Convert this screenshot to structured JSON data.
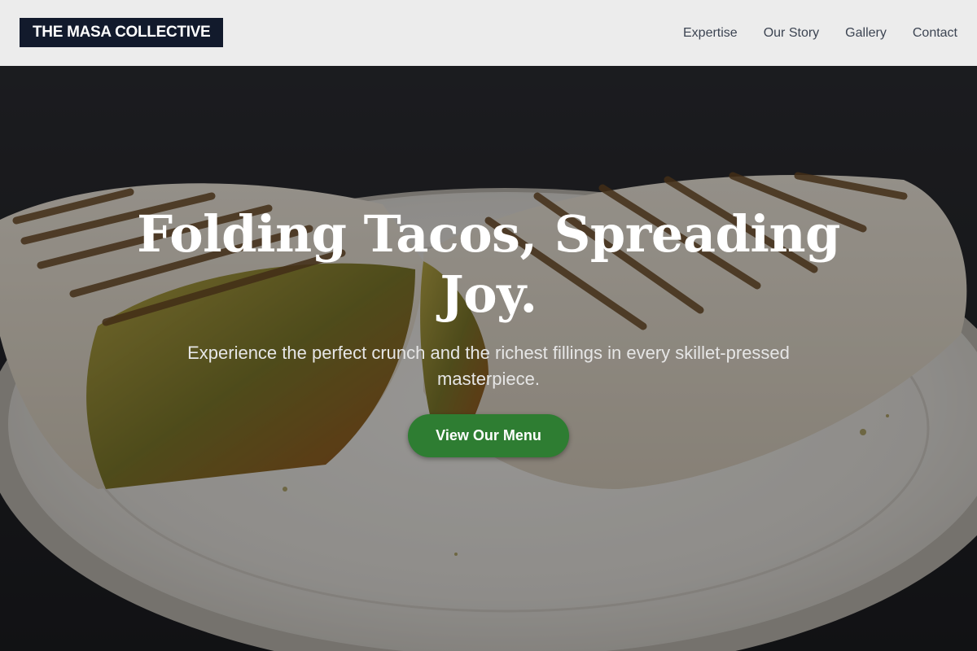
{
  "header": {
    "brand": "THE MASA COLLECTIVE",
    "nav": [
      {
        "label": "Expertise"
      },
      {
        "label": "Our Story"
      },
      {
        "label": "Gallery"
      },
      {
        "label": "Contact"
      }
    ]
  },
  "hero": {
    "title": "Folding Tacos, Spreading Joy.",
    "subtitle": "Experience the perfect crunch and the richest fillings in every skillet-pressed masterpiece.",
    "cta_label": "View Our Menu"
  },
  "colors": {
    "header_bg": "#ececec",
    "brand_bg": "#121a2c",
    "cta_bg": "#2e7d32",
    "nav_text": "#3c4452"
  }
}
